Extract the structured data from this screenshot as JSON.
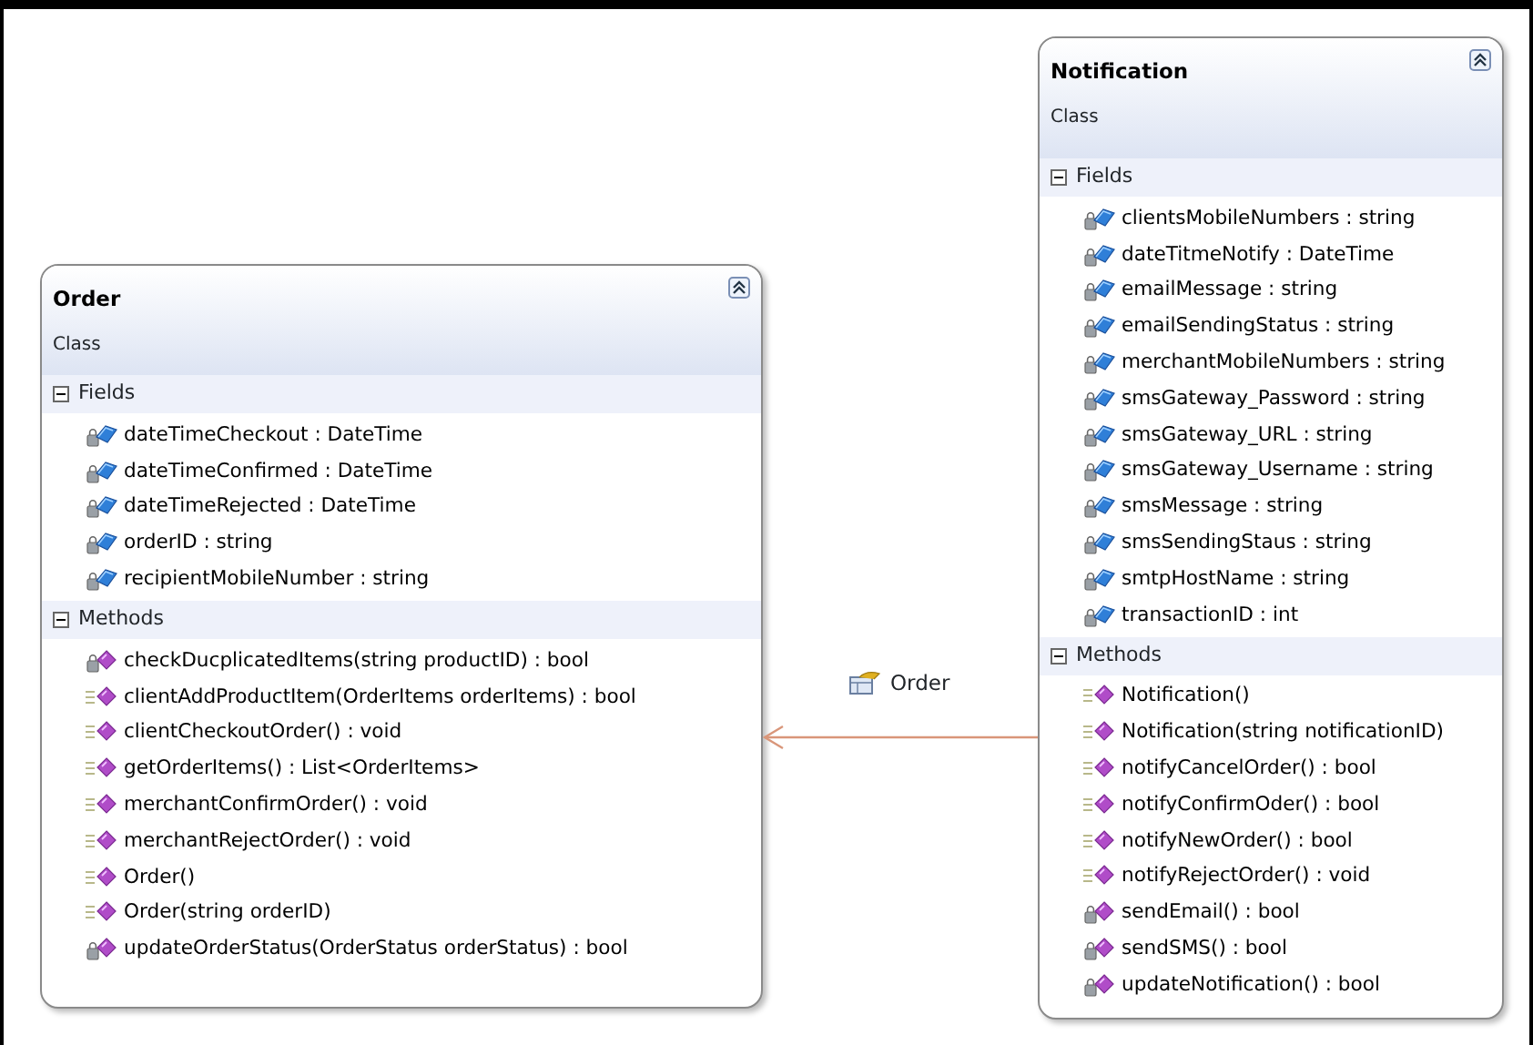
{
  "classes": [
    {
      "name": "Order",
      "stereotype": "Class",
      "sections": [
        {
          "title": "Fields",
          "expanded": true,
          "members": [
            {
              "text": "dateTimeCheckout : DateTime",
              "kind": "private_field"
            },
            {
              "text": "dateTimeConfirmed : DateTime",
              "kind": "private_field"
            },
            {
              "text": "dateTimeRejected : DateTime",
              "kind": "private_field"
            },
            {
              "text": "orderID : string",
              "kind": "private_field"
            },
            {
              "text": "recipientMobileNumber : string",
              "kind": "private_field"
            }
          ]
        },
        {
          "title": "Methods",
          "expanded": true,
          "members": [
            {
              "text": "checkDucplicatedItems(string productID) : bool",
              "kind": "private_method"
            },
            {
              "text": "clientAddProductItem(OrderItems orderItems) : bool",
              "kind": "public_method"
            },
            {
              "text": "clientCheckoutOrder() : void",
              "kind": "public_method"
            },
            {
              "text": "getOrderItems() : List<OrderItems>",
              "kind": "public_method"
            },
            {
              "text": "merchantConfirmOrder() : void",
              "kind": "public_method"
            },
            {
              "text": "merchantRejectOrder() : void",
              "kind": "public_method"
            },
            {
              "text": "Order()",
              "kind": "public_method"
            },
            {
              "text": "Order(string orderID)",
              "kind": "public_method"
            },
            {
              "text": "updateOrderStatus(OrderStatus orderStatus) : bool",
              "kind": "private_method"
            }
          ]
        }
      ]
    },
    {
      "name": "Notification",
      "stereotype": "Class",
      "sections": [
        {
          "title": "Fields",
          "expanded": true,
          "members": [
            {
              "text": "clientsMobileNumbers : string",
              "kind": "private_field"
            },
            {
              "text": "dateTitmeNotify : DateTime",
              "kind": "private_field"
            },
            {
              "text": "emailMessage : string",
              "kind": "private_field"
            },
            {
              "text": "emailSendingStatus : string",
              "kind": "private_field"
            },
            {
              "text": "merchantMobileNumbers : string",
              "kind": "private_field"
            },
            {
              "text": "smsGateway_Password : string",
              "kind": "private_field"
            },
            {
              "text": "smsGateway_URL : string",
              "kind": "private_field"
            },
            {
              "text": "smsGateway_Username : string",
              "kind": "private_field"
            },
            {
              "text": "smsMessage : string",
              "kind": "private_field"
            },
            {
              "text": "smsSendingStaus : string",
              "kind": "private_field"
            },
            {
              "text": "smtpHostName : string",
              "kind": "private_field"
            },
            {
              "text": "transactionID : int",
              "kind": "private_field"
            }
          ]
        },
        {
          "title": "Methods",
          "expanded": true,
          "members": [
            {
              "text": "Notification()",
              "kind": "public_method"
            },
            {
              "text": "Notification(string notificationID)",
              "kind": "public_method"
            },
            {
              "text": "notifyCancelOrder() : bool",
              "kind": "public_method"
            },
            {
              "text": "notifyConfirmOder() : bool",
              "kind": "public_method"
            },
            {
              "text": "notifyNewOrder() : bool",
              "kind": "public_method"
            },
            {
              "text": "notifyRejectOrder() : void",
              "kind": "public_method"
            },
            {
              "text": "sendEmail() : bool",
              "kind": "private_method"
            },
            {
              "text": "sendSMS() : bool",
              "kind": "private_method"
            },
            {
              "text": "updateNotification() : bool",
              "kind": "private_method"
            }
          ]
        }
      ]
    }
  ],
  "association": {
    "label": "Order"
  }
}
